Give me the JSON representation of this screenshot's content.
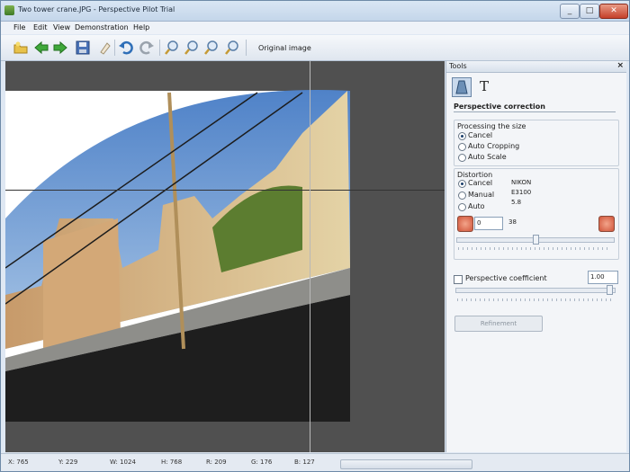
{
  "window": {
    "title": "Two tower crane.JPG - Perspective Pilot Trial",
    "min_glyph": "_",
    "max_glyph": "□",
    "close_glyph": "✕"
  },
  "menu": [
    "File",
    "Edit",
    "View",
    "Demonstration",
    "Help"
  ],
  "toolbar": {
    "buttons": [
      "open-icon",
      "back-arrow-icon",
      "forward-arrow-icon",
      "save-icon",
      "clear-icon",
      "undo-icon",
      "redo-icon",
      "zoom-in-icon",
      "zoom-out-icon",
      "zoom-fit-icon",
      "zoom-actual-icon"
    ],
    "original_image_label": "Original image"
  },
  "tools": {
    "title": "Tools",
    "close": "×",
    "text_tab_glyph": "T",
    "section_title": "Perspective correction",
    "processing": {
      "title": "Processing the size",
      "options": [
        "Cancel",
        "Auto Cropping",
        "Auto Scale"
      ],
      "selected": "Cancel"
    },
    "distortion": {
      "title": "Distortion",
      "options": [
        "Cancel",
        "Manual",
        "Auto"
      ],
      "selected": "Cancel",
      "camera": [
        "NIKON",
        "E3100",
        "5.8"
      ],
      "value": "0",
      "focal": "38",
      "slider_fraction": 0.5
    },
    "perspective_coefficient": {
      "label": "Perspective coefficient",
      "value": "1.00",
      "checked": false,
      "slider_fraction": 0.99
    },
    "refinement_label": "Refinement"
  },
  "status": {
    "x": "X: 765",
    "y": "Y: 229",
    "w": "W: 1024",
    "h": "H: 768",
    "r": "R: 209",
    "g": "G: 176",
    "b": "B: 127"
  }
}
